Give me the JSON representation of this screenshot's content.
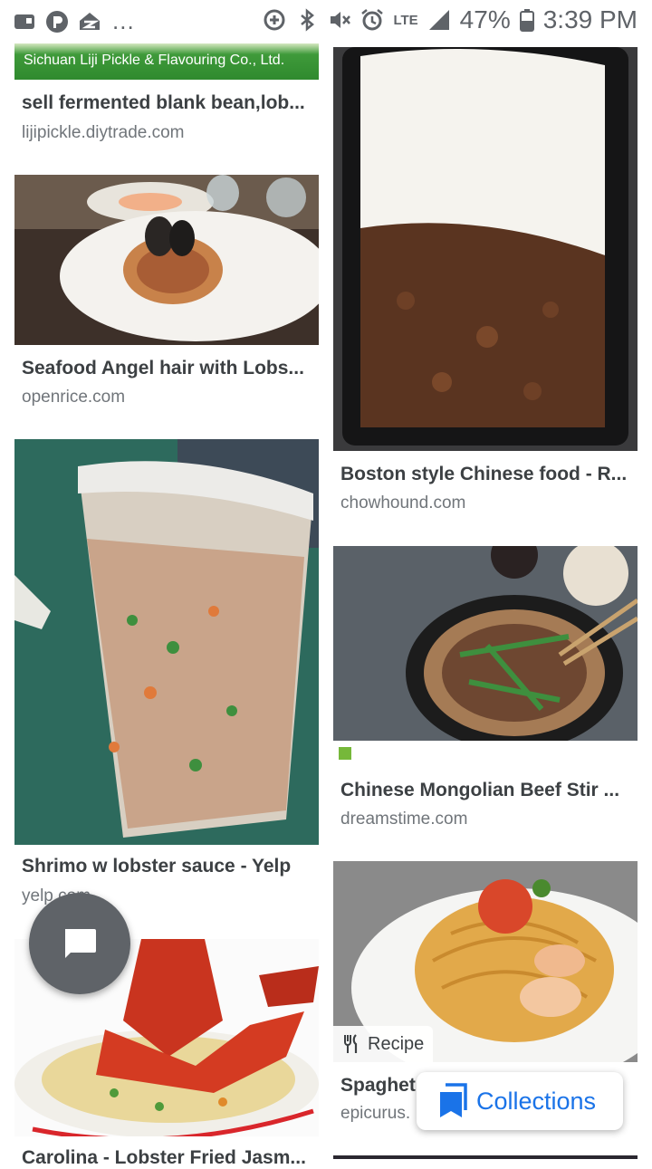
{
  "status_bar": {
    "left_icons": [
      "gallery-icon",
      "pandora-icon",
      "zillow-icon"
    ],
    "more": "...",
    "battery": "47%",
    "time": "3:39 PM",
    "network": "LTE"
  },
  "cards": [
    {
      "id": "c1",
      "banner_text": "Sichuan Liji Pickle & Flavouring Co., Ltd.",
      "title": "sell fermented blank bean,lob...",
      "domain": "lijipickle.diytrade.com"
    },
    {
      "id": "c2",
      "title": "Seafood Angel hair with Lobs...",
      "domain": "openrice.com"
    },
    {
      "id": "c3",
      "title": "Shrimo w lobster sauce - Yelp",
      "domain": "yelp.com"
    },
    {
      "id": "c4",
      "title": "Carolina - Lobster Fried Jasm...",
      "domain": ""
    },
    {
      "id": "c5",
      "title": "Boston style Chinese food - R...",
      "domain": "chowhound.com"
    },
    {
      "id": "c6",
      "title": "Chinese Mongolian Beef Stir ...",
      "domain": "dreamstime.com"
    },
    {
      "id": "c7",
      "title": "Spaghet",
      "domain": "epicurus.",
      "badge": "Recipe"
    }
  ],
  "collections_label": "Collections",
  "colors": {
    "accent": "#1a73e8",
    "fab": "#5f6368",
    "muted": "#70757a"
  }
}
